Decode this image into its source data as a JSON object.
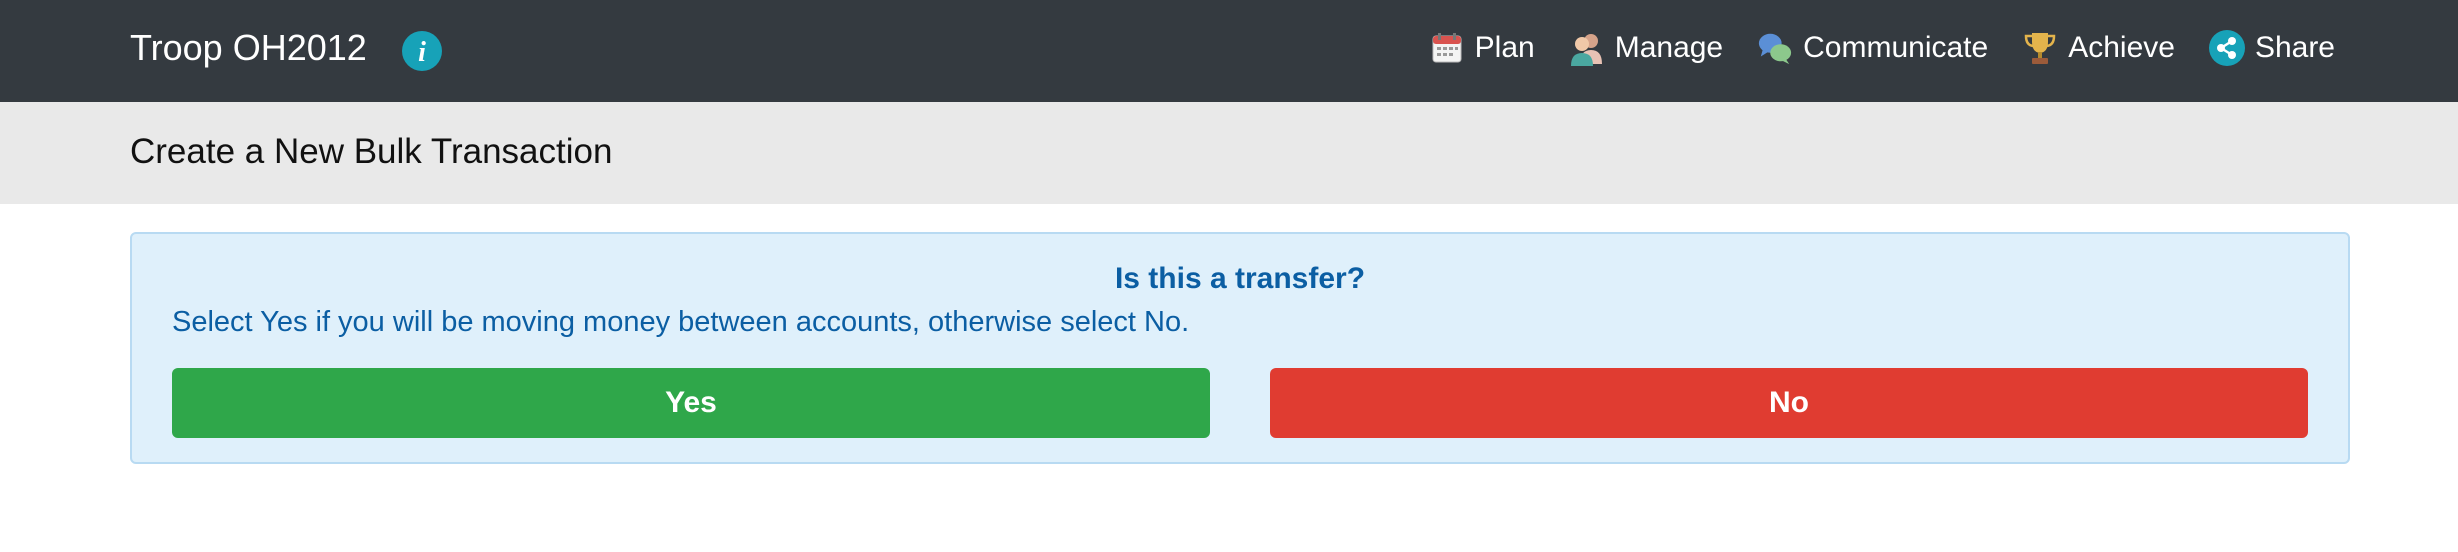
{
  "navbar": {
    "brand": "Troop OH2012",
    "info_icon": "info-icon",
    "items": [
      {
        "label": "Plan",
        "icon": "calendar-icon"
      },
      {
        "label": "Manage",
        "icon": "people-icon"
      },
      {
        "label": "Communicate",
        "icon": "speech-bubbles-icon"
      },
      {
        "label": "Achieve",
        "icon": "trophy-icon"
      },
      {
        "label": "Share",
        "icon": "share-icon"
      }
    ]
  },
  "page_header": {
    "title": "Create a New Bulk Transaction"
  },
  "alert": {
    "heading": "Is this a transfer?",
    "text": "Select Yes if you will be moving money between accounts, otherwise select No.",
    "yes_label": "Yes",
    "no_label": "No"
  },
  "colors": {
    "navbar_bg": "#343a40",
    "header_bg": "#e9e9e9",
    "alert_bg": "#dff0fb",
    "alert_text": "#0b5ea3",
    "yes_button": "#2fa74a",
    "no_button": "#e03c31",
    "info_icon": "#17a2b8"
  }
}
